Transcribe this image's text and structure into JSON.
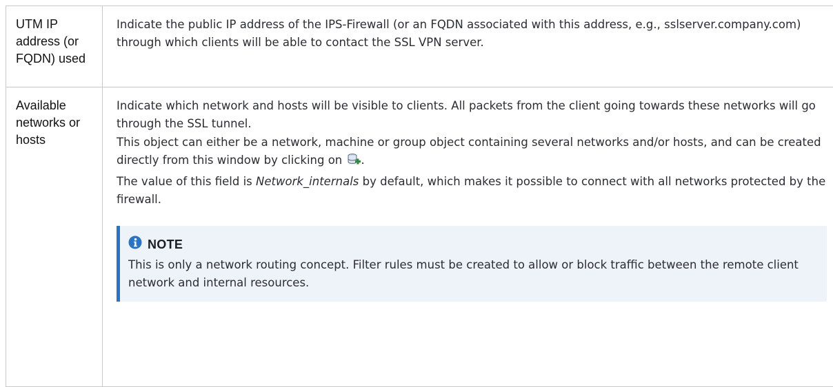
{
  "rows": [
    {
      "term": "UTM IP address (or FQDN) used",
      "desc": "Indicate the public IP address of the IPS-Firewall (or an FQDN associated with this address, e.g., sslserver.company.com) through which clients will be able to contact the SSL VPN server."
    },
    {
      "term": "Available networks or hosts",
      "p1": "Indicate which network and hosts will be visible to clients. All packets from the client going towards these networks will go through the SSL tunnel.",
      "p2_before_icon": "This object can either be a network, machine or group object containing several networks and/or hosts, and can be created directly from this window by clicking on ",
      "p2_after_icon": ".",
      "p2_icon": "database-add-icon",
      "p3_before": "The value of this field is ",
      "p3_italic": "Network_internals",
      "p3_after": " by default, which makes it possible to connect with all networks protected by the firewall.",
      "note": {
        "icon": "info-icon",
        "title": "NOTE",
        "text": "This is only a network routing concept. Filter rules must be created to allow or block traffic between the remote client network and internal resources."
      }
    }
  ],
  "colors": {
    "accent": "#2b73c4",
    "note_bg": "#eef3fa",
    "border": "#c8c8c8"
  }
}
